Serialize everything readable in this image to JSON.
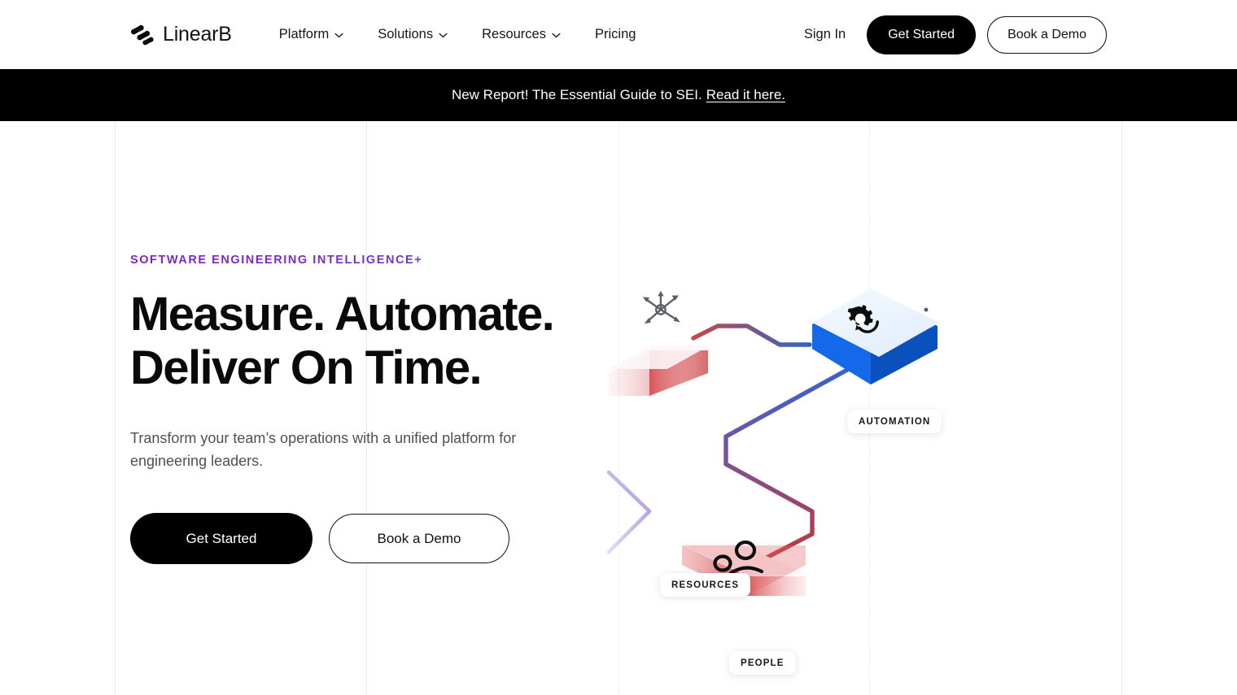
{
  "header": {
    "brand": {
      "name": "LinearB",
      "logo_icon": "linearb-logo-icon"
    },
    "nav": [
      {
        "label": "Platform",
        "has_dropdown": true
      },
      {
        "label": "Solutions",
        "has_dropdown": true
      },
      {
        "label": "Resources",
        "has_dropdown": true
      },
      {
        "label": "Pricing",
        "has_dropdown": false
      }
    ],
    "sign_in": "Sign In",
    "get_started": "Get Started",
    "book_demo": "Book a Demo"
  },
  "banner": {
    "text": "New Report! The Essential Guide to SEI.",
    "link_text": "Read it here."
  },
  "hero": {
    "eyebrow": "SOFTWARE ENGINEERING INTELLIGENCE+",
    "headline_line1": "Measure. Automate.",
    "headline_line2": "Deliver On Time.",
    "subhead": "Transform your team’s operations with a unified platform for engineering leaders.",
    "cta_primary": "Get Started",
    "cta_secondary": "Book a Demo"
  },
  "illustration": {
    "badges": [
      {
        "id": "automation",
        "label": "AUTOMATION"
      },
      {
        "id": "resources",
        "label": "RESOURCES"
      },
      {
        "id": "people",
        "label": "PEOPLE"
      }
    ],
    "nodes": [
      {
        "id": "resources-node",
        "icon": "network-nodes-icon",
        "color": "#d23c40"
      },
      {
        "id": "automation-node",
        "icon": "gear-refresh-icon",
        "color": "#1565e0"
      },
      {
        "id": "people-node",
        "icon": "people-group-icon",
        "color": "#d4484c"
      }
    ],
    "colors": {
      "accent_blue": "#1565e0",
      "accent_red": "#c8393f",
      "accent_purple": "#a88ae0",
      "line_blue": "#2f6fd0",
      "line_red": "#c04a4e"
    }
  },
  "theme": {
    "background": "#ffffff",
    "text_primary": "#0a0a0b",
    "text_secondary": "#4b5059",
    "banner_bg": "#000000",
    "grid_line": "#ededf1",
    "eyebrow_gradient_start": "#8024bf",
    "eyebrow_gradient_end": "#6a52d8"
  }
}
